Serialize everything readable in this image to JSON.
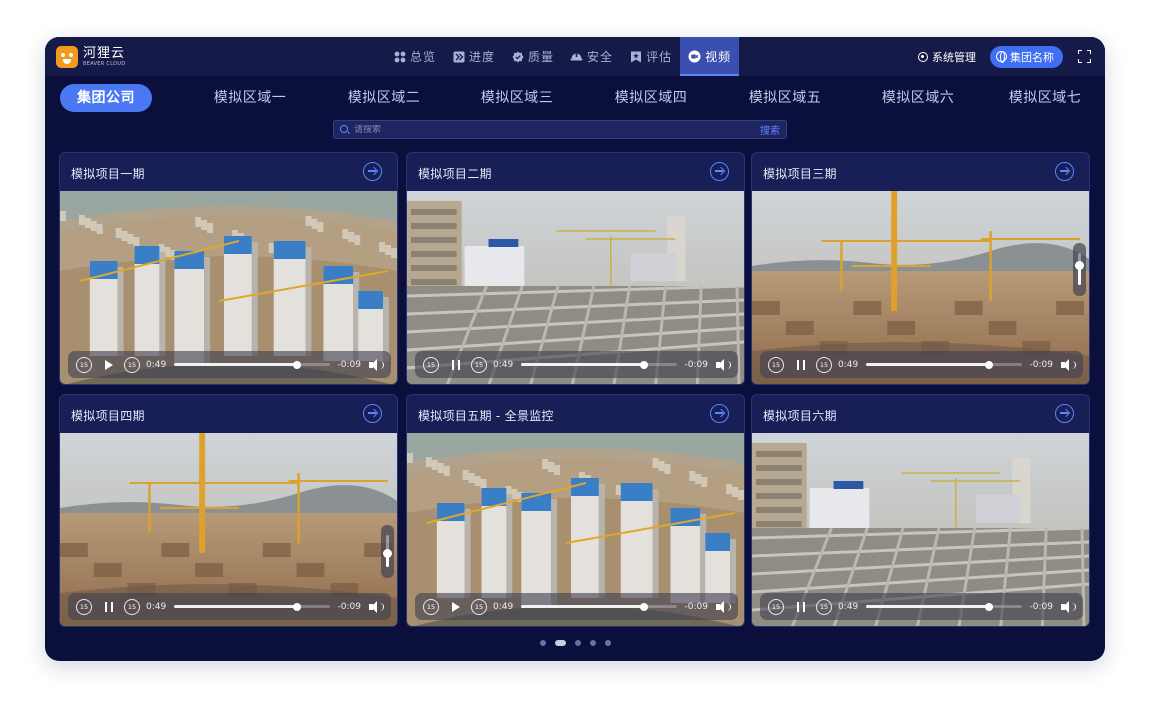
{
  "app": {
    "brand_name": "河狸云",
    "brand_sub": "BEAVER CLOUD"
  },
  "nav": {
    "items": [
      {
        "label": "总览",
        "icon": "grid-icon",
        "active": false
      },
      {
        "label": "进度",
        "icon": "progress-icon",
        "active": false
      },
      {
        "label": "质量",
        "icon": "quality-badge-icon",
        "active": false
      },
      {
        "label": "安全",
        "icon": "helmet-icon",
        "active": false
      },
      {
        "label": "评估",
        "icon": "bookmark-icon",
        "active": false
      },
      {
        "label": "视频",
        "icon": "video-icon",
        "active": true
      }
    ],
    "system_label": "系统管理",
    "group_label": "集团名称"
  },
  "regions": {
    "items": [
      {
        "label": "集团公司",
        "active": true
      },
      {
        "label": "模拟区域一",
        "active": false
      },
      {
        "label": "模拟区域二",
        "active": false
      },
      {
        "label": "模拟区域三",
        "active": false
      },
      {
        "label": "模拟区域四",
        "active": false
      },
      {
        "label": "模拟区域五",
        "active": false
      },
      {
        "label": "模拟区域六",
        "active": false
      },
      {
        "label": "模拟区域七",
        "active": false
      }
    ]
  },
  "search": {
    "placeholder": "请搜索",
    "button_label": "搜索"
  },
  "videos": [
    {
      "title": "模拟项目一期",
      "scene": "aerial",
      "playing": false,
      "skip_seconds": "15",
      "elapsed": "0:49",
      "remaining": "-0:09",
      "progress": 0.79,
      "volume_popup": false
    },
    {
      "title": "模拟项目二期",
      "scene": "pit",
      "playing": true,
      "skip_seconds": "15",
      "elapsed": "0:49",
      "remaining": "-0:09",
      "progress": 0.79,
      "volume_popup": false
    },
    {
      "title": "模拟项目三期",
      "scene": "cranes",
      "playing": true,
      "skip_seconds": "15",
      "elapsed": "0:49",
      "remaining": "-0:09",
      "progress": 0.79,
      "volume_popup": true,
      "volume": 0.6
    },
    {
      "title": "模拟项目四期",
      "scene": "cranes",
      "playing": true,
      "skip_seconds": "15",
      "elapsed": "0:49",
      "remaining": "-0:09",
      "progress": 0.79,
      "volume_popup": true,
      "volume": 0.4
    },
    {
      "title": "模拟项目五期 - 全景监控",
      "scene": "aerial",
      "playing": false,
      "skip_seconds": "15",
      "elapsed": "0:49",
      "remaining": "-0:09",
      "progress": 0.79,
      "volume_popup": false
    },
    {
      "title": "模拟项目六期",
      "scene": "pit",
      "playing": true,
      "skip_seconds": "15",
      "elapsed": "0:49",
      "remaining": "-0:09",
      "progress": 0.79,
      "volume_popup": false
    }
  ],
  "pager": {
    "count": 5,
    "active": 1
  },
  "colors": {
    "background": "#0b0f3c",
    "topbar": "#151a48",
    "accent": "#4a78f2",
    "link_icon": "#5b86ff",
    "brand_logo": "#f29a1f"
  }
}
